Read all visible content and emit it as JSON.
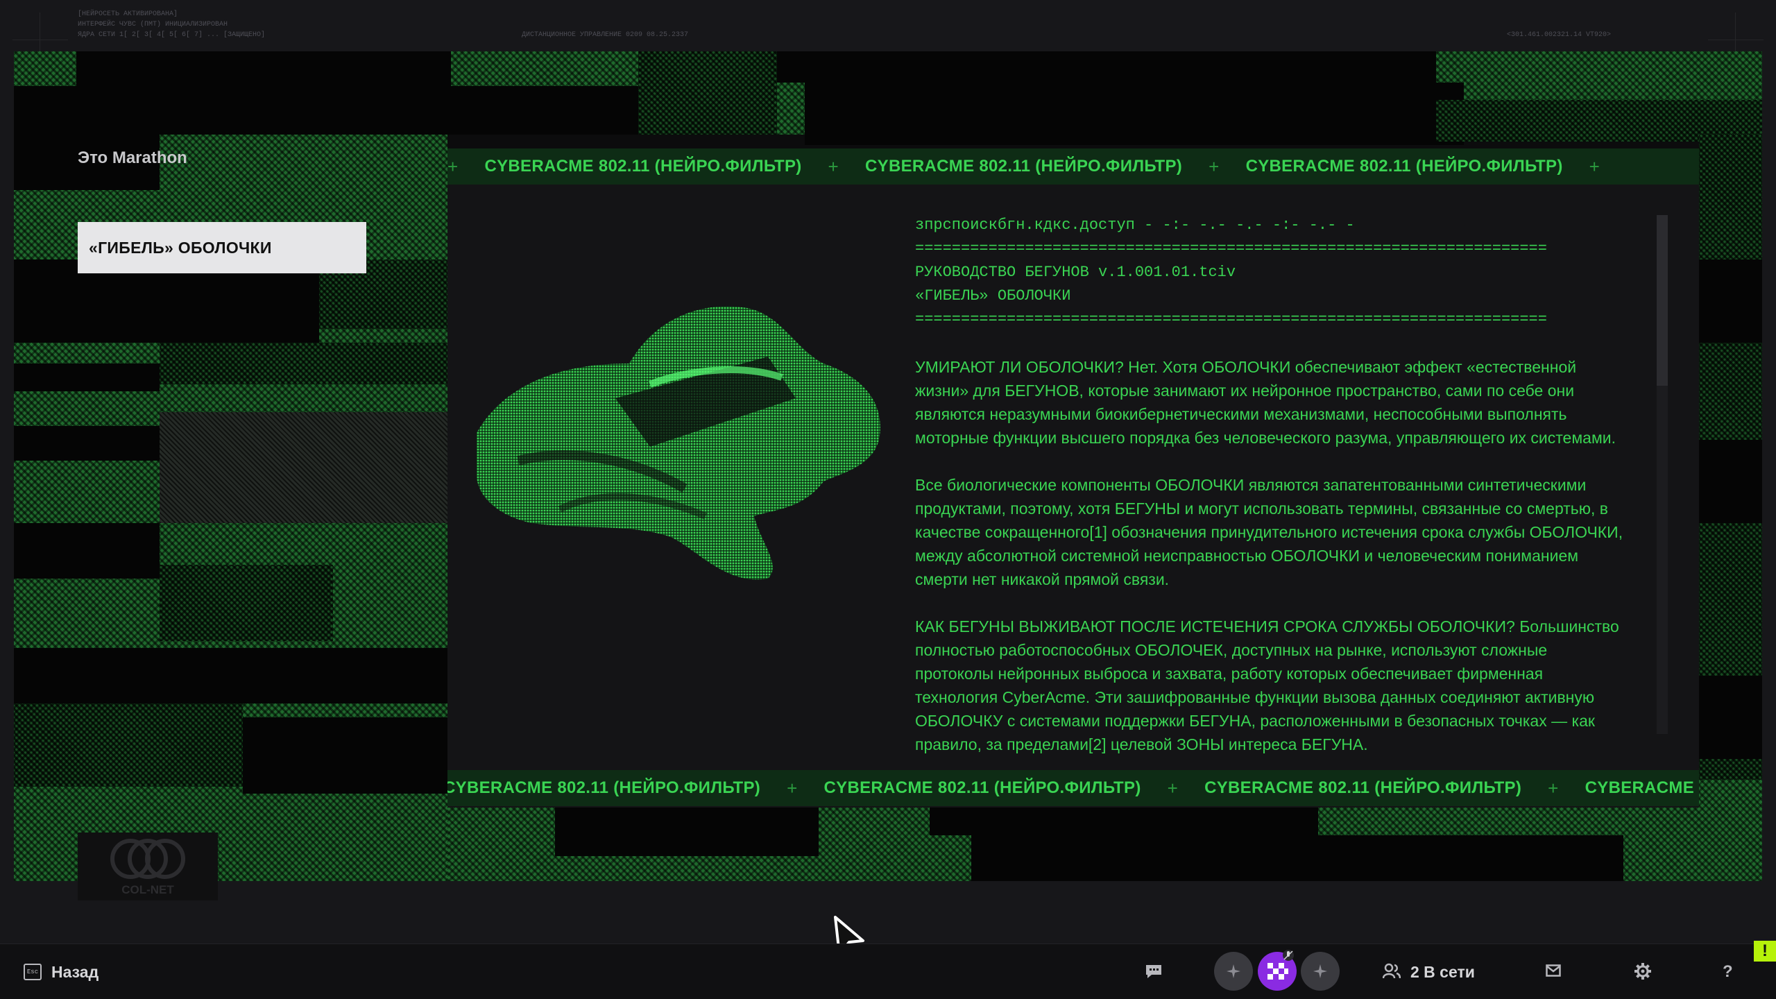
{
  "top_info": {
    "left_lines": [
      "[НЕЙРОСЕТЬ АКТИВИРОВАНА]",
      "ИНТЕРФЕЙС ЧУВС (ПМТ) ИНИЦИАЛИЗИРОВАН",
      "ЯДРА СЕТИ 1[ 2[ 3[ 4[ 5[ 6[ 7] ... [ЗАЩИЩЕНО]"
    ],
    "center_line": "ДИСТАНЦИОННОЕ УПРАВЛЕНИЕ 0209 08.25.2337",
    "right_line": "<301.461.002321.14 VT920>"
  },
  "sidebar": {
    "section_title": "Это Marathon",
    "items": [
      {
        "label": "«ГИБЕЛЬ» ОБОЛОЧКИ",
        "selected": true
      }
    ]
  },
  "logo": {
    "text": "COL-NET"
  },
  "modal": {
    "ticker_text": "CYBERACME 802.11 (НЕЙРО.ФИЛЬТР)",
    "ticker_separator": "+",
    "header_lines": [
      "зпрспоискбгн.кдкс.доступ                - -:- -.- -.- -:- -.- -",
      "=====================================================================",
      "РУКОВОДСТВО БЕГУНОВ                       v.1.001.01.tciv",
      "«ГИБЕЛЬ» ОБОЛОЧКИ",
      "====================================================================="
    ],
    "paragraphs": [
      "УМИРАЮТ ЛИ ОБОЛОЧКИ? Нет. Хотя ОБОЛОЧКИ обеспечивают эффект «естественной жизни» для БЕГУНОВ, которые занимают их нейронное пространство, сами по себе они являются неразумными биокибернетическими механизмами, неспособными выполнять моторные функции высшего порядка без человеческого разума, управляющего их системами.",
      "Все биологические компоненты ОБОЛОЧКИ являются запатентованными синтетическими продуктами, поэтому, хотя БЕГУНЫ и могут использовать термины, связанные со смертью, в качестве сокращенного[1] обозначения принудительного истечения срока службы ОБОЛОЧКИ, между абсолютной системной неисправностью ОБОЛОЧКИ и человеческим пониманием смерти нет никакой прямой связи.",
      "КАК БЕГУНЫ ВЫЖИВАЮТ ПОСЛЕ ИСТЕЧЕНИЯ СРОКА СЛУЖБЫ ОБОЛОЧКИ? Большинство полностью работоспособных ОБОЛОЧЕК, доступных на рынке, используют сложные протоколы нейронных выброса и захвата, работу которых обеспечивает фирменная технология CyberAcme. Эти зашифрованные функции вызова данных соединяют активную ОБОЛОЧКУ с системами поддержки БЕГУНА, расположенными в безопасных точках — как правило, за пределами[2] целевой ЗОНЫ интереса БЕГУНА."
    ]
  },
  "bottom_bar": {
    "esc_key": "Esc",
    "back_label": "Назад",
    "online_label": "2 В сети",
    "help_label": "?",
    "alert_label": "!"
  },
  "colors": {
    "accent_green": "#3ad453",
    "ticker_bg": "#0e2c15",
    "nav_selected_bg": "#e6e6e8",
    "party_purple": "#8a2be2"
  }
}
